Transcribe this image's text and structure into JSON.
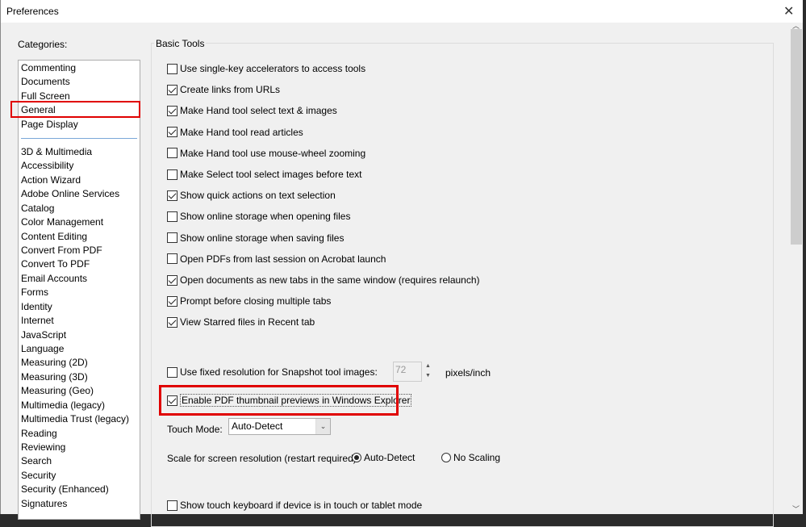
{
  "window": {
    "title": "Preferences",
    "close_icon": "close-icon"
  },
  "categories": {
    "label": "Categories:",
    "top": [
      "Commenting",
      "Documents",
      "Full Screen",
      "General",
      "Page Display"
    ],
    "items": [
      "3D & Multimedia",
      "Accessibility",
      "Action Wizard",
      "Adobe Online Services",
      "Catalog",
      "Color Management",
      "Content Editing",
      "Convert From PDF",
      "Convert To PDF",
      "Email Accounts",
      "Forms",
      "Identity",
      "Internet",
      "JavaScript",
      "Language",
      "Measuring (2D)",
      "Measuring (3D)",
      "Measuring (Geo)",
      "Multimedia (legacy)",
      "Multimedia Trust (legacy)",
      "Reading",
      "Reviewing",
      "Search",
      "Security",
      "Security (Enhanced)",
      "Signatures"
    ],
    "selected": "General",
    "highlight_color": "#e00000"
  },
  "basic_tools": {
    "label": "Basic Tools",
    "options": [
      {
        "label": "Use single-key accelerators to access tools",
        "checked": false
      },
      {
        "label": "Create links from URLs",
        "checked": true
      },
      {
        "label": "Make Hand tool select text & images",
        "checked": true
      },
      {
        "label": "Make Hand tool read articles",
        "checked": true
      },
      {
        "label": "Make Hand tool use mouse-wheel zooming",
        "checked": false
      },
      {
        "label": "Make Select tool select images before text",
        "checked": false
      },
      {
        "label": "Show quick actions on text selection",
        "checked": true
      },
      {
        "label": "Show online storage when opening files",
        "checked": false
      },
      {
        "label": "Show online storage when saving files",
        "checked": false
      },
      {
        "label": "Open PDFs from last session on Acrobat launch",
        "checked": false
      },
      {
        "label": "Open documents as new tabs in the same window (requires relaunch)",
        "checked": true
      },
      {
        "label": "Prompt before closing multiple tabs",
        "checked": true
      },
      {
        "label": "View Starred files in Recent tab",
        "checked": true
      }
    ],
    "snapshot": {
      "label": "Use fixed resolution for Snapshot tool images:",
      "checked": false,
      "value": "72",
      "unit": "pixels/inch"
    },
    "thumbnail": {
      "label": "Enable PDF thumbnail previews in Windows Explorer",
      "checked": true
    },
    "touch_mode": {
      "label": "Touch Mode:",
      "value": "Auto-Detect"
    },
    "scale": {
      "label": "Scale for screen resolution (restart required):",
      "options": [
        "Auto-Detect",
        "No Scaling"
      ],
      "selected": "Auto-Detect"
    },
    "touch_keyboard": {
      "label": "Show touch keyboard if device is in touch or tablet mode",
      "checked": false
    }
  }
}
